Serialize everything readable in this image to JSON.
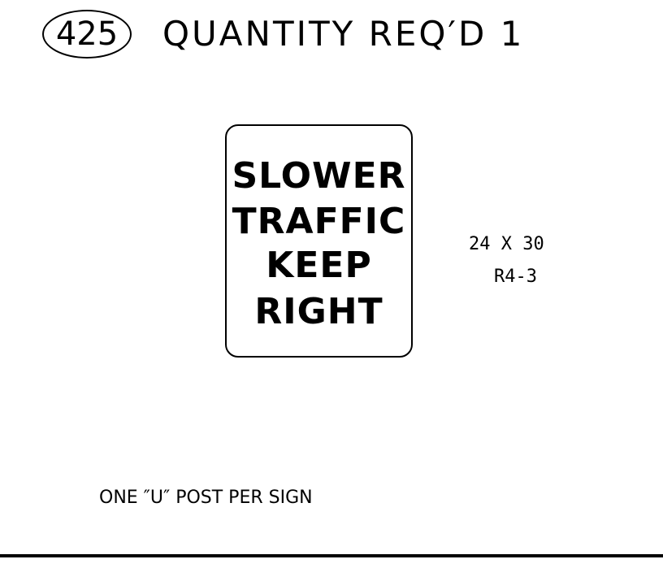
{
  "header": {
    "item_number": "425",
    "quantity_text": "QUANTITY REQ′D 1"
  },
  "sign": {
    "lines": [
      "SLOWER",
      "TRAFFIC",
      "KEEP",
      "RIGHT"
    ],
    "size": "24 X 30",
    "code": "R4-3"
  },
  "note": "ONE ″U″ POST PER SIGN",
  "colors": {
    "ink": "#000000",
    "background": "#ffffff"
  }
}
